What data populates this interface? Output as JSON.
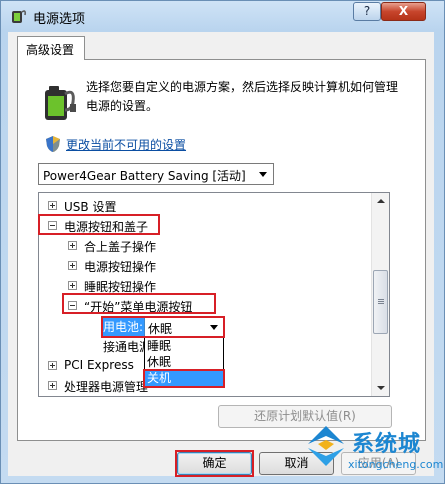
{
  "window": {
    "title": "电源选项",
    "help_label": "?",
    "close_label": "X"
  },
  "tab": {
    "label": "高级设置"
  },
  "description": "选择您要自定义的电源方案，然后选择反映计算机如何管理电源的设置。",
  "link": "更改当前不可用的设置",
  "plan_select": {
    "value": "Power4Gear Battery Saving [活动]"
  },
  "tree": {
    "items": [
      {
        "label": "USB 设置",
        "expander": "+"
      },
      {
        "label": "电源按钮和盖子",
        "expander": "-"
      },
      {
        "label": "合上盖子操作",
        "expander": "+"
      },
      {
        "label": "电源按钮操作",
        "expander": "+"
      },
      {
        "label": "睡眠按钮操作",
        "expander": "+"
      },
      {
        "label": "“开始”菜单电源按钮",
        "expander": "-"
      },
      {
        "label": "用电池:"
      },
      {
        "label": "接通电源"
      },
      {
        "label": "PCI Express",
        "expander": "+"
      },
      {
        "label": "处理器电源管理",
        "expander": "+"
      }
    ],
    "inline_combo_value": "休眠",
    "dropdown_options": [
      "睡眠",
      "休眠",
      "关机"
    ],
    "dropdown_selected": "关机"
  },
  "restore_button": "还原计划默认值(R)",
  "buttons": {
    "ok": "确定",
    "cancel": "取消",
    "apply": "应用(A)"
  },
  "watermark": {
    "brand": "系统城",
    "url": "xitongcheng.com"
  },
  "colors": {
    "highlight": "#3399ff",
    "annotation_red": "#d71f26",
    "link": "#0b4ea2"
  }
}
